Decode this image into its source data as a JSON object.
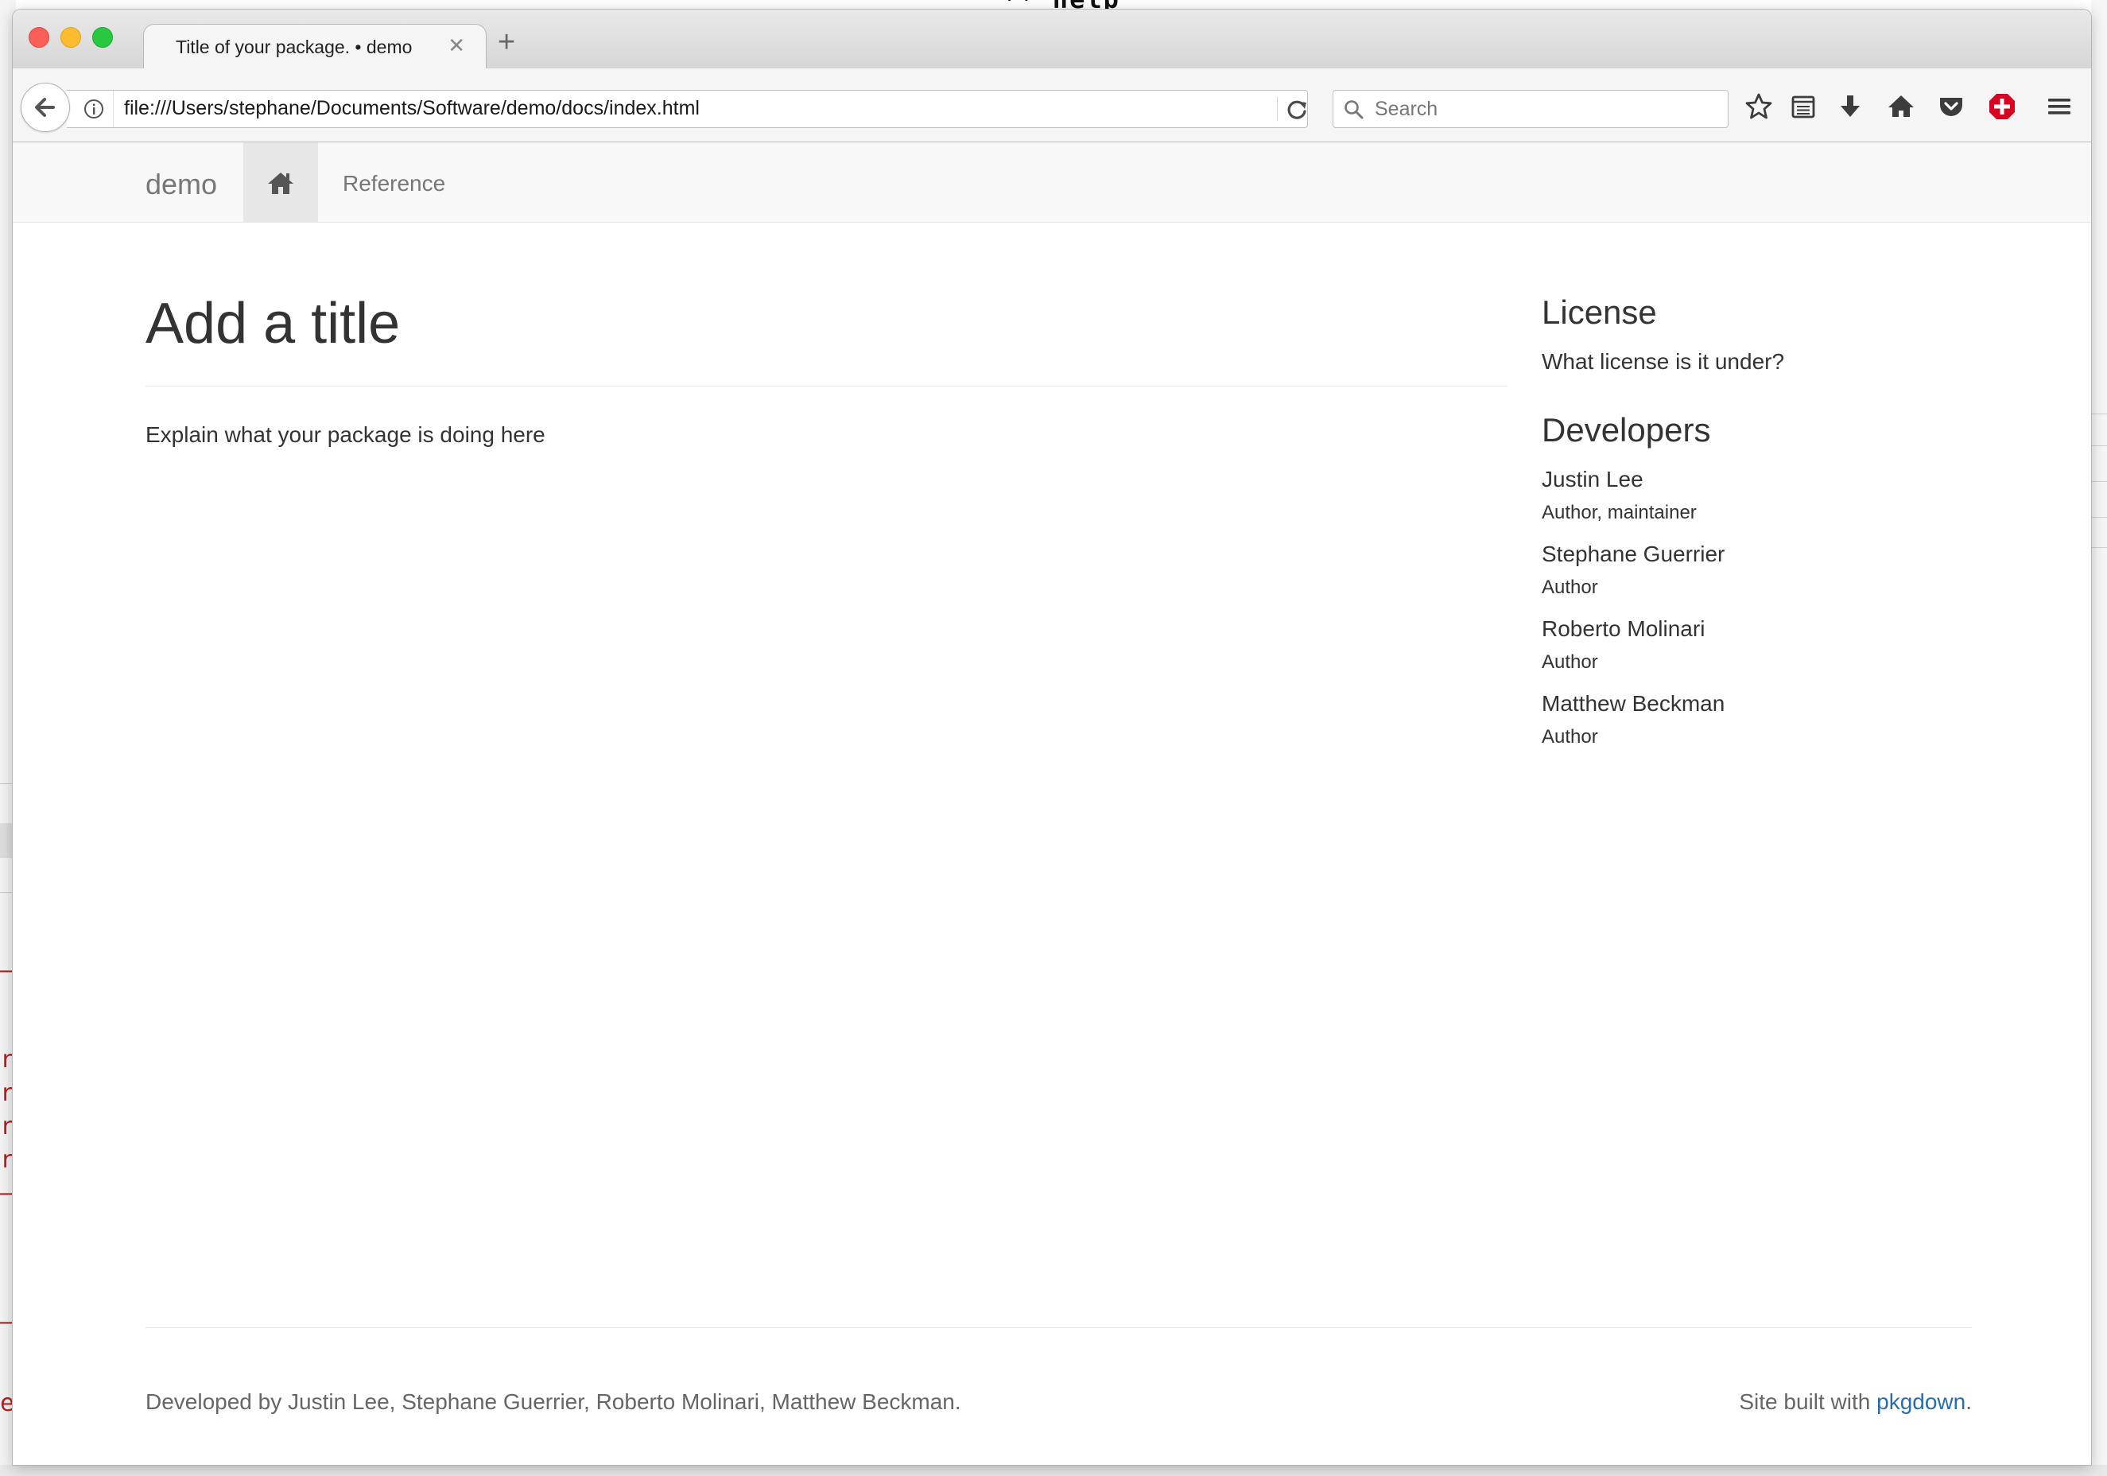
{
  "background": {
    "terminal_snippet": "** help",
    "left_pane_marks": [
      "—",
      "r",
      "r",
      "r",
      "r",
      "—",
      "—",
      "e"
    ]
  },
  "browser": {
    "tab": {
      "title": "Title of your package. • demo",
      "close_glyph": "✕"
    },
    "new_tab_glyph": "+",
    "url": "file:///Users/stephane/Documents/Software/demo/docs/index.html",
    "search_placeholder": "Search",
    "toolbar_icons": [
      "star-icon",
      "reading-list-icon",
      "download-icon",
      "home-icon",
      "pocket-icon",
      "addon-plus-icon",
      "menu-icon"
    ],
    "colors": {
      "close": "#fc5f57",
      "minimize": "#fdbc2e",
      "maximize": "#28c840",
      "addon_red": "#d70022"
    }
  },
  "site": {
    "brand": "demo",
    "nav": {
      "home_icon": "home-icon",
      "reference": "Reference"
    },
    "title": "Add a title",
    "intro": "Explain what your package is doing here",
    "sidebar": {
      "license_heading": "License",
      "license_text": "What license is it under?",
      "developers_heading": "Developers",
      "developers": [
        {
          "name": "Justin Lee",
          "role": "Author, maintainer"
        },
        {
          "name": "Stephane Guerrier",
          "role": "Author"
        },
        {
          "name": "Roberto Molinari",
          "role": "Author"
        },
        {
          "name": "Matthew Beckman",
          "role": "Author"
        }
      ]
    },
    "footer": {
      "left": "Developed by Justin Lee, Stephane Guerrier, Roberto Molinari, Matthew Beckman.",
      "right_prefix": "Site built with ",
      "right_link": "pkgdown",
      "right_suffix": "."
    },
    "colors": {
      "link": "#2c6ca8",
      "text": "#333333",
      "muted": "#777777"
    }
  }
}
